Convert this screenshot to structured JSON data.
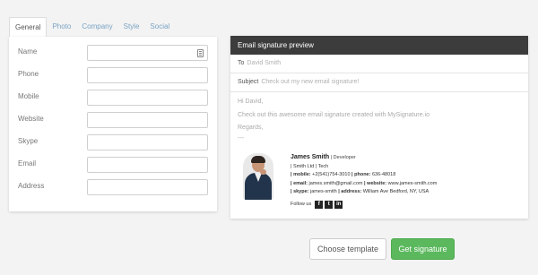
{
  "tabs": [
    "General",
    "Photo",
    "Company",
    "Style",
    "Social"
  ],
  "form": {
    "fields": [
      {
        "label": "Name",
        "value": ""
      },
      {
        "label": "Phone",
        "value": ""
      },
      {
        "label": "Mobile",
        "value": ""
      },
      {
        "label": "Website",
        "value": ""
      },
      {
        "label": "Skype",
        "value": ""
      },
      {
        "label": "Email",
        "value": ""
      },
      {
        "label": "Address",
        "value": ""
      }
    ]
  },
  "preview": {
    "title": "Email signature preview",
    "to_label": "To",
    "to_value": "David Smith",
    "subject_label": "Subject",
    "subject_value": "Check out my new email signature!",
    "greeting": "Hi David,",
    "line1": "Check out this awesome email signature created with MySignature.io",
    "regards": "Regards,",
    "dashes": "---"
  },
  "signature": {
    "name": "James Smith",
    "role": "| Developer",
    "company": "| Smith Ltd | Tech",
    "mobile_label": "| mobile:",
    "mobile": "+2(541)754-3010",
    "phone_label": "| phone:",
    "phone": "636-48018",
    "email_label": "| email:",
    "email": "james.smith@gmail.com",
    "website_label": "| website:",
    "website": "www.james-smith.com",
    "skype_label": "| skype:",
    "skype": "james-smith",
    "address_label": "| address:",
    "address": "William Ave Bedford, NY, USA",
    "follow_label": "Follow us",
    "social": [
      "f",
      "t",
      "in"
    ]
  },
  "buttons": {
    "choose": "Choose template",
    "get": "Get signature"
  },
  "colors": {
    "accent_green": "#5bb85d",
    "header_dark": "#3c3c3c",
    "tab_link": "#7aa3c4"
  }
}
